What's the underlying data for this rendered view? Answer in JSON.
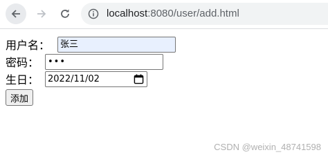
{
  "browser": {
    "url_host": "localhost",
    "url_rest": ":8080/user/add.html"
  },
  "form": {
    "username_label": "用户名：",
    "username_value": "张三",
    "password_label": "密码：",
    "password_value": "•••",
    "birthday_label": "生日：",
    "birthday_value": "2022/11/02",
    "submit_label": "添加"
  },
  "watermark": "CSDN @weixin_48741598",
  "icons": {
    "back": "arrow-left-icon",
    "forward": "arrow-right-icon",
    "reload": "reload-icon",
    "site_info": "info-icon",
    "calendar": "calendar-icon"
  },
  "colors": {
    "autofill_background": "#e8f0fe",
    "toolbar_button_hover": "#e8eaed",
    "omnibox_background": "#f1f3f4"
  }
}
